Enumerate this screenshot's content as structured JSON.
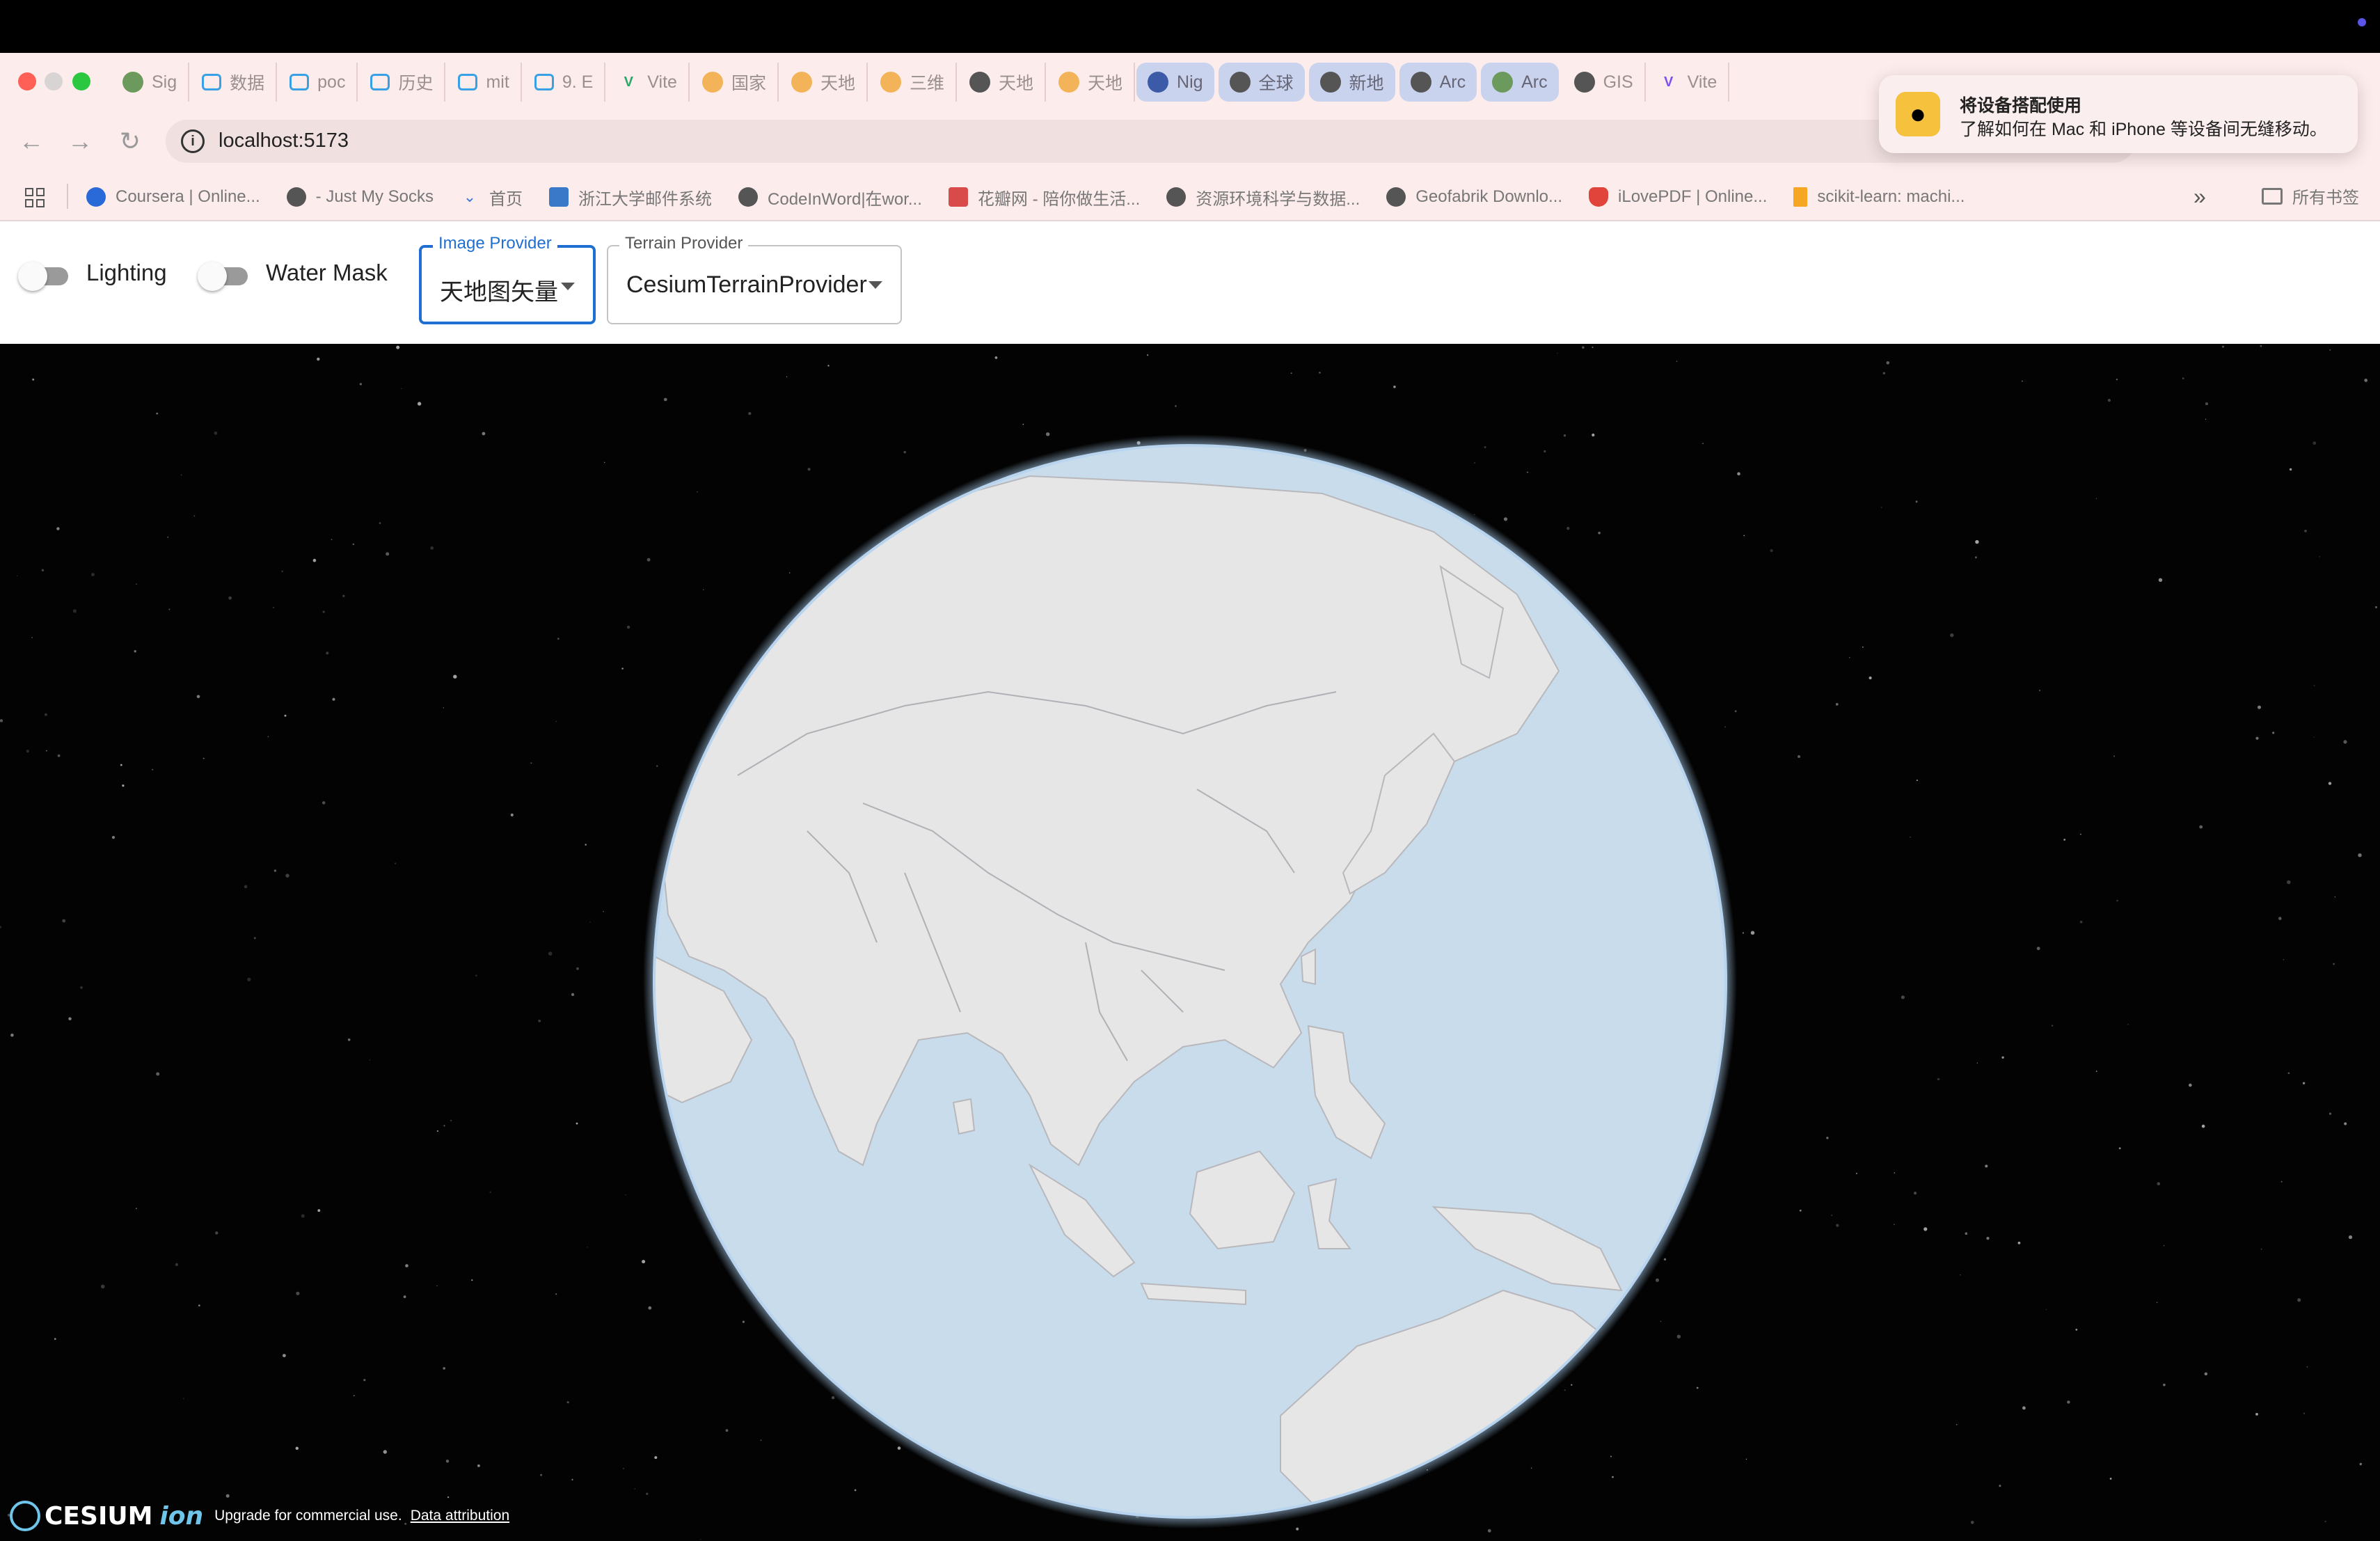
{
  "browser": {
    "tabs": [
      {
        "label": "Sig",
        "icon": "chart-icon"
      },
      {
        "label": "数据",
        "icon": "bilibili-icon"
      },
      {
        "label": "poc",
        "icon": "bilibili-icon"
      },
      {
        "label": "历史",
        "icon": "bilibili-icon"
      },
      {
        "label": "mit",
        "icon": "bilibili-icon"
      },
      {
        "label": "9. E",
        "icon": "bilibili-icon"
      },
      {
        "label": "Vite",
        "icon": "vue-icon"
      },
      {
        "label": "国家",
        "icon": "tianditu-icon"
      },
      {
        "label": "天地",
        "icon": "tianditu-icon"
      },
      {
        "label": "三维",
        "icon": "tianditu-icon"
      },
      {
        "label": "天地",
        "icon": "globe-icon"
      },
      {
        "label": "天地",
        "icon": "tianditu-icon"
      },
      {
        "label": "Nig",
        "icon": "nasa-icon"
      },
      {
        "label": "全球",
        "icon": "record-icon"
      },
      {
        "label": "新地",
        "icon": "github-icon"
      },
      {
        "label": "Arc",
        "icon": "globe-icon"
      },
      {
        "label": "Arc",
        "icon": "chart-icon"
      },
      {
        "label": "GIS",
        "icon": "globe-icon"
      },
      {
        "label": "Vite",
        "icon": "vite-icon"
      }
    ],
    "address": "localhost:5173",
    "bookmarks": [
      {
        "label": "Coursera | Online..."
      },
      {
        "label": "- Just My Socks"
      },
      {
        "label": "首页"
      },
      {
        "label": "浙江大学邮件系统"
      },
      {
        "label": "CodeInWord|在wor..."
      },
      {
        "label": "花瓣网 - 陪你做生活..."
      },
      {
        "label": "资源环境科学与数据..."
      },
      {
        "label": "Geofabrik Downlo..."
      },
      {
        "label": "iLovePDF | Online..."
      },
      {
        "label": "scikit-learn: machi..."
      }
    ],
    "bookmarks_more": "»",
    "all_bookmarks": "所有书签"
  },
  "notification": {
    "title": "将设备搭配使用",
    "body": "了解如何在 Mac 和 iPhone 等设备间无缝移动。"
  },
  "toolbar": {
    "lighting": {
      "label": "Lighting",
      "on": false
    },
    "water_mask": {
      "label": "Water Mask",
      "on": false
    },
    "image_provider": {
      "legend": "Image Provider",
      "value": "天地图矢量"
    },
    "terrain_provider": {
      "legend": "Terrain Provider",
      "value": "CesiumTerrainProvider"
    }
  },
  "viewer": {
    "credit": {
      "logo": "CESIUM",
      "logo_suffix": "ion",
      "upgrade": "Upgrade for commercial use.",
      "attribution": "Data attribution"
    },
    "colors": {
      "ocean": "#c9dcec",
      "land": "#e6e6e6",
      "space": "#030303",
      "atmosphere": "#a9cdee"
    }
  }
}
